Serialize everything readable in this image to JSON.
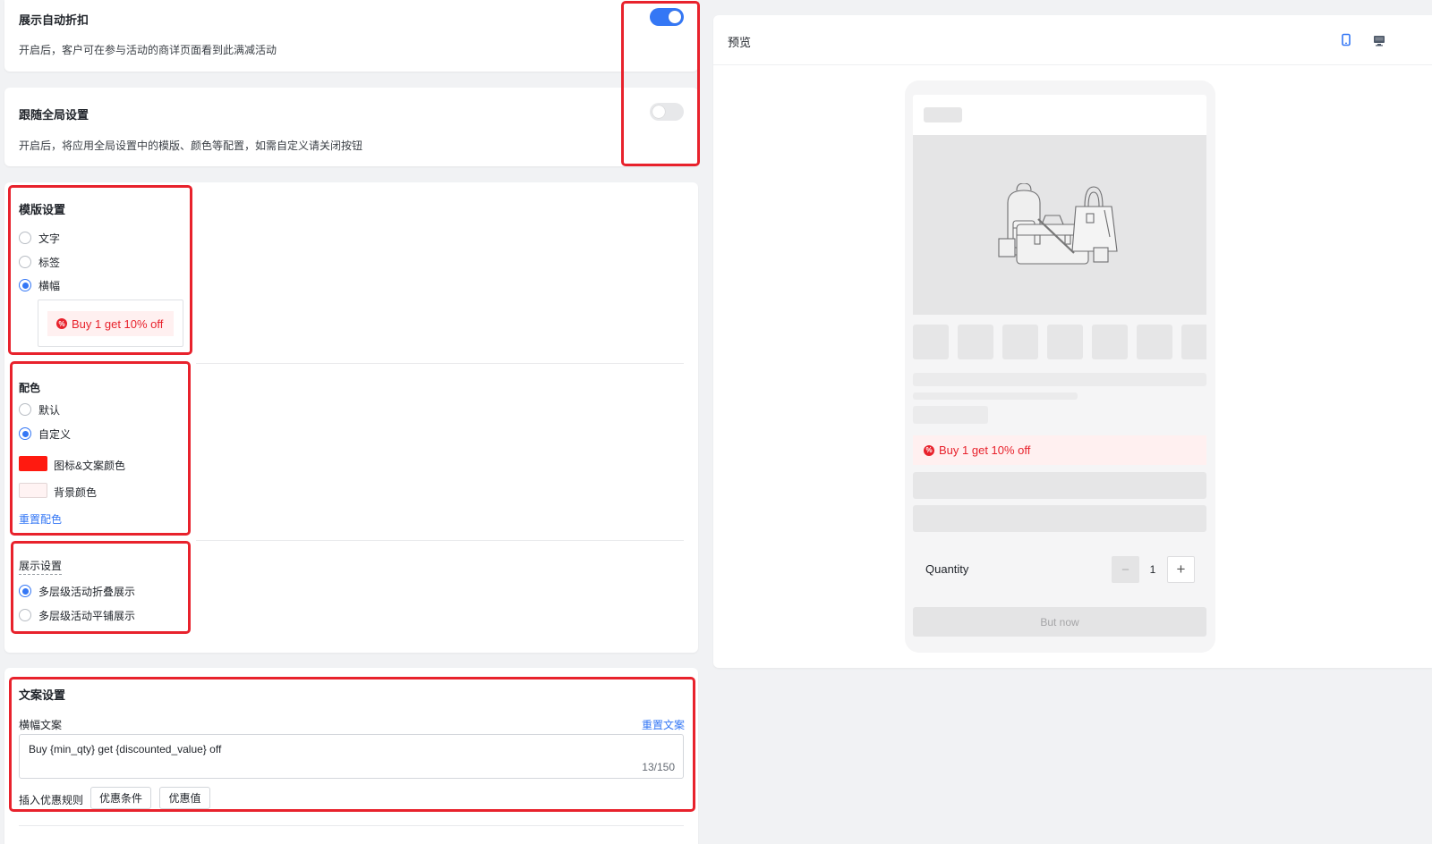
{
  "auto_discount": {
    "title": "展示自动折扣",
    "desc": "开启后，客户可在参与活动的商详页面看到此满减活动",
    "enabled": true
  },
  "global_settings": {
    "title": "跟随全局设置",
    "desc": "开启后，将应用全局设置中的模版、颜色等配置，如需自定义请关闭按钮",
    "enabled": false
  },
  "template": {
    "title": "模版设置",
    "options": [
      "文字",
      "标签",
      "横幅"
    ],
    "selected": "横幅",
    "banner_preview": "Buy 1 get 10% off"
  },
  "color": {
    "title": "配色",
    "options": [
      "默认",
      "自定义"
    ],
    "selected": "自定义",
    "icon_text_label": "图标&文案颜色",
    "icon_text_color": "#ff1a10",
    "background_label": "背景颜色",
    "background_color": "#fff3f3",
    "reset_label": "重置配色"
  },
  "display": {
    "title": "展示设置",
    "options": [
      "多层级活动折叠展示",
      "多层级活动平铺展示"
    ],
    "selected": "多层级活动折叠展示"
  },
  "copy": {
    "title": "文案设置",
    "banner_label": "横幅文案",
    "reset_label": "重置文案",
    "text_value": "Buy {min_qty} get {discounted_value} off",
    "counter": "13/150",
    "insert_label": "插入优惠规则",
    "btn_condition": "优惠条件",
    "btn_value": "优惠值"
  },
  "preview": {
    "title": "预览",
    "banner_text": "Buy 1 get 10% off",
    "quantity_label": "Quantity",
    "quantity_value": "1",
    "buy_label": "But now",
    "icons": [
      "mobile-icon",
      "desktop-icon"
    ],
    "accent": "#3477f5"
  }
}
